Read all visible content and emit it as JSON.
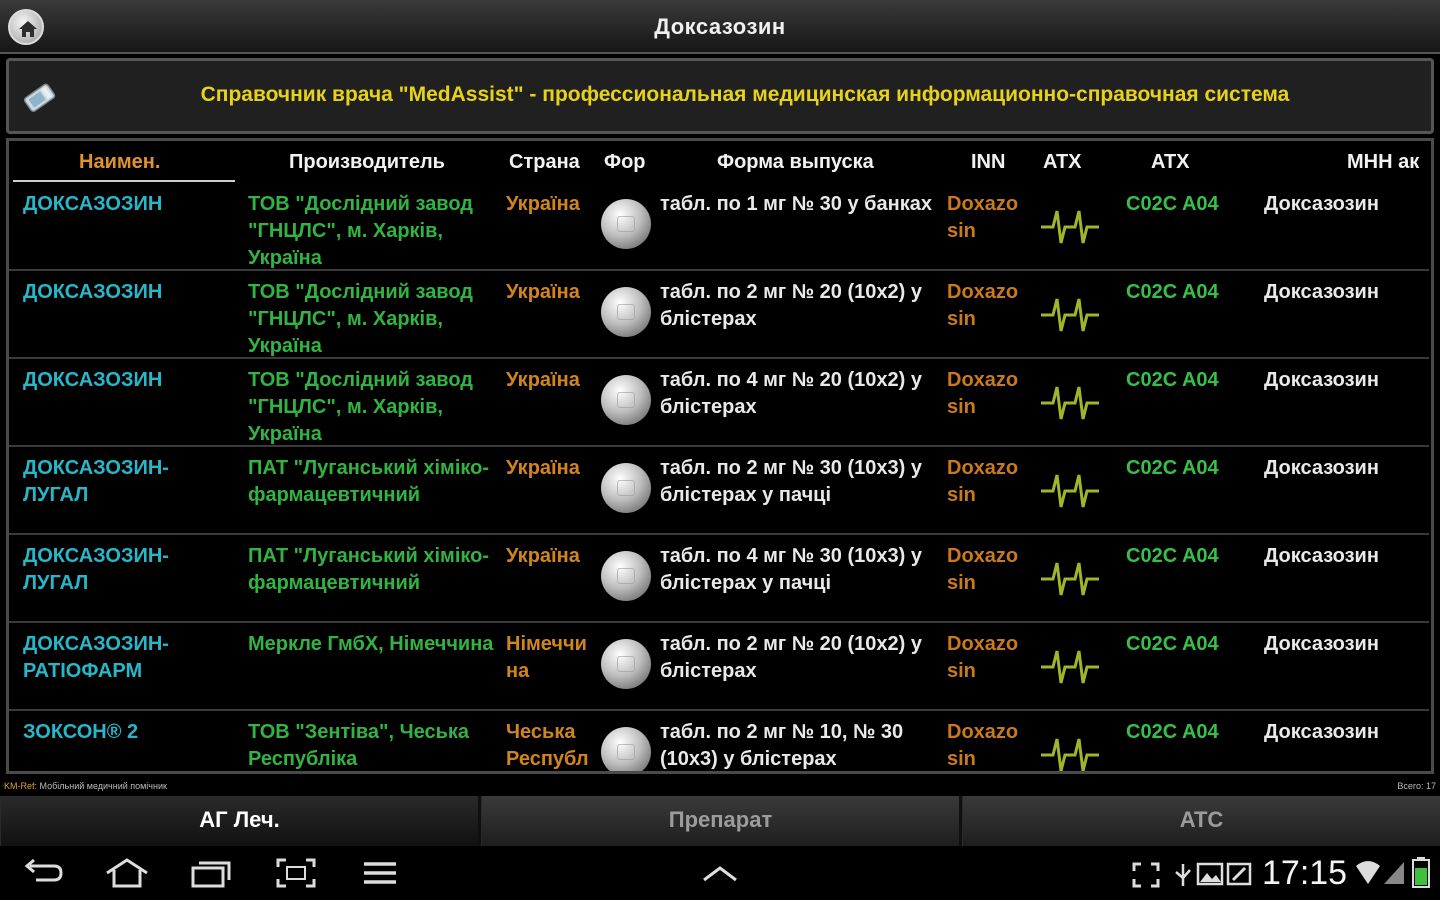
{
  "header": {
    "title": "Доксазозин"
  },
  "banner": {
    "text": "Справочник врача \"MedAssist\" - профессиональная медицинская информационно-справочная система"
  },
  "table": {
    "columns": {
      "name": "Наимен.",
      "maker": "Производитель",
      "country": "Страна",
      "form_icon": "Фор",
      "form": "Форма выпуска",
      "inn": "INN",
      "atx_icon": "ATX",
      "atx": "ATX",
      "mnn": "МНН ак"
    },
    "rows": [
      {
        "name": "ДОКСАЗОЗИН",
        "maker": "ТОВ \"Дослідний завод \"ГНЦЛС\", м. Харків, Україна",
        "country": "Україна",
        "form": "табл. по 1 мг № 30 у банках",
        "inn": "Doxazo sin",
        "atc": "C02C A04",
        "mnn": "Доксазозин"
      },
      {
        "name": "ДОКСАЗОЗИН",
        "maker": "ТОВ \"Дослідний завод \"ГНЦЛС\", м. Харків, Україна",
        "country": "Україна",
        "form": "табл. по 2 мг № 20 (10х2) у блістерах",
        "inn": "Doxazo sin",
        "atc": "C02C A04",
        "mnn": "Доксазозин"
      },
      {
        "name": "ДОКСАЗОЗИН",
        "maker": "ТОВ \"Дослідний завод \"ГНЦЛС\", м. Харків, Україна",
        "country": "Україна",
        "form": "табл. по 4 мг № 20 (10х2) у блістерах",
        "inn": "Doxazo sin",
        "atc": "C02C A04",
        "mnn": "Доксазозин"
      },
      {
        "name": "ДОКСАЗОЗИН-ЛУГАЛ",
        "maker": "ПАТ \"Луганський хіміко-фармацевтичний",
        "country": "Україна",
        "form": "табл. по 2 мг № 30 (10х3) у блістерах у пачці",
        "inn": "Doxazo sin",
        "atc": "C02C A04",
        "mnn": "Доксазозин"
      },
      {
        "name": "ДОКСАЗОЗИН-ЛУГАЛ",
        "maker": "ПАТ \"Луганський хіміко-фармацевтичний",
        "country": "Україна",
        "form": "табл. по 4 мг № 30 (10х3) у блістерах у пачці",
        "inn": "Doxazo sin",
        "atc": "C02C A04",
        "mnn": "Доксазозин"
      },
      {
        "name": "ДОКСАЗОЗИН-РАТІОФАРМ",
        "maker": "Меркле ГмбХ, Німеччина",
        "country": "Німеччи на",
        "form": "табл. по 2 мг № 20 (10х2) у блістерах",
        "inn": "Doxazo sin",
        "atc": "C02C A04",
        "mnn": "Доксазозин"
      },
      {
        "name": "ЗОКСОН® 2",
        "maker": "ТОВ \"Зентіва\", Чеська Республіка",
        "country": "Чеська Республ",
        "form": "табл. по 2 мг № 10, № 30 (10х3) у блістерах",
        "inn": "Doxazo sin",
        "atc": "C02C A04",
        "mnn": "Доксазозин"
      }
    ]
  },
  "status": {
    "app_name": "KM-Ref:",
    "app_desc": "Мобільний медичний помічник",
    "total": "Всего: 17"
  },
  "tabs": [
    {
      "label": "АГ Леч."
    },
    {
      "label": "Препарат"
    },
    {
      "label": "ATC"
    }
  ],
  "navbar": {
    "clock": "17:15"
  },
  "icons": {
    "home": "home-icon",
    "banner": "pill-bottle-icon",
    "pill": "pill-icon",
    "ecg": "ecg-icon",
    "back": "back-icon",
    "home_nav": "home-nav-icon",
    "recent": "recent-apps-icon",
    "screenshot": "screenshot-icon",
    "menu": "menu-icon",
    "up": "chevron-up-icon",
    "wifi": "wifi-icon",
    "signal": "signal-icon",
    "battery": "battery-icon"
  },
  "colors": {
    "name": "#28b6c9",
    "maker": "#32b342",
    "country": "#d2841e",
    "atc": "#38bf4a",
    "banner_text": "#e7d21a",
    "header_name": "#e0922d"
  }
}
